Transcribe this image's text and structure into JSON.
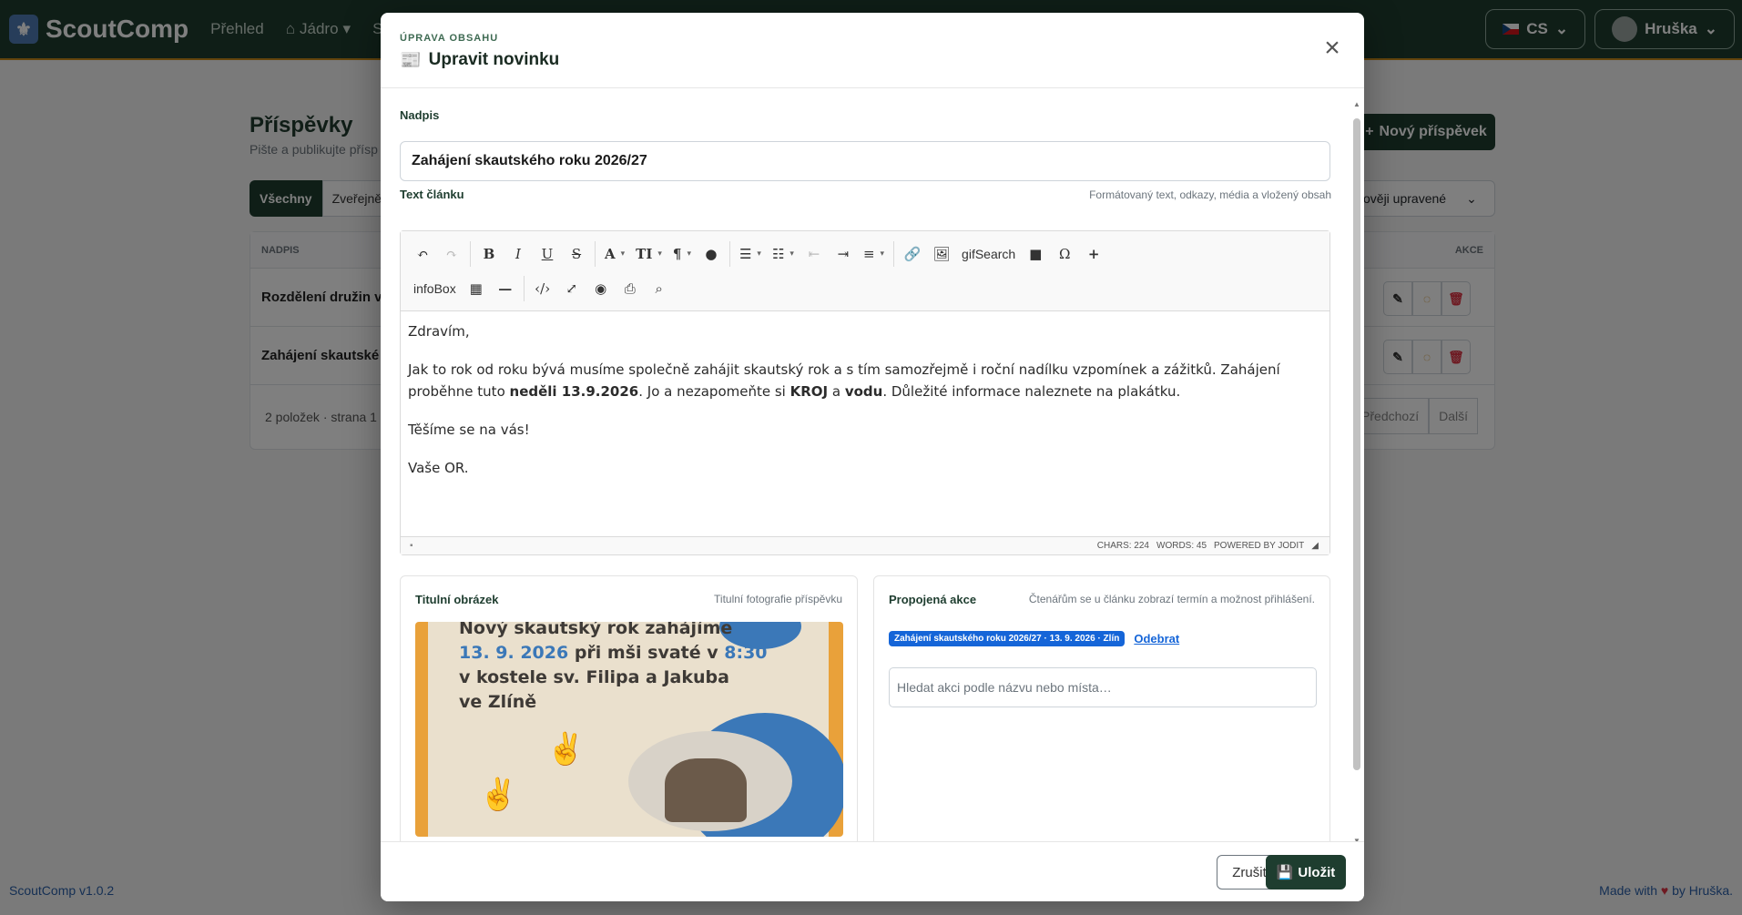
{
  "navbar": {
    "brand": "ScoutComp",
    "links": [
      "Přehled",
      "Jádro",
      "Sk"
    ],
    "lang": "CS",
    "user": "Hruška"
  },
  "page": {
    "title": "Příspěvky",
    "subtitle": "Pište a publikujte přísp",
    "new_button": "Nový příspěvek",
    "tabs": [
      "Všechny",
      "Zveřejněn"
    ],
    "sort": "ověji upravené",
    "table": {
      "col_title": "NADPIS",
      "col_actions": "AKCE",
      "rows": [
        "Rozdělení družin v",
        "Zahájení skautské"
      ]
    },
    "footer_count": "2 položek · strana 1",
    "prev": "Předchozí",
    "next": "Další"
  },
  "footer": {
    "version": "ScoutComp v1.0.2",
    "made_prefix": "Made with",
    "made_suffix": "by Hruška."
  },
  "modal": {
    "eyebrow": "ÚPRAVA OBSAHU",
    "title": "Upravit novinku",
    "heading_label": "Nadpis",
    "heading_value": "Zahájení skautského roku 2026/27",
    "text_label": "Text článku",
    "text_hint": "Formátovaný text, odkazy, média a vložený obsah",
    "toolbar": {
      "gif": "gifSearch",
      "infobox": "infoBox"
    },
    "content": {
      "p1": "Zdravím,",
      "p2_a": "Jak to rok od roku bývá musíme společně zahájit skautský rok a s tím samozřejmě i roční nadílku vzpomínek a zážitků. Zahájení proběhne tuto ",
      "p2_b": "neděli 13.9.2026",
      "p2_c": ". Jo a nezapomeňte si ",
      "p2_d": "KROJ",
      "p2_e": " a ",
      "p2_f": "vodu",
      "p2_g": ". Důležité informace naleznete na plakátku.",
      "p3": "Těšíme se na vás!",
      "p4": "Vaše OR."
    },
    "status": {
      "chars": "CHARS: 224",
      "words": "WORDS: 45",
      "powered": "POWERED BY JODIT"
    },
    "cover": {
      "title": "Titulní obrázek",
      "hint": "Titulní fotografie příspěvku",
      "poster_line1": "Nový skautský rok zahájíme",
      "poster_line2a": "13. 9. 2026",
      "poster_line2b": " při mši svaté v ",
      "poster_line2c": "8:30",
      "poster_line3": "v kostele sv. Filipa a Jakuba",
      "poster_line4": "ve Zlíně"
    },
    "event": {
      "title": "Propojená akce",
      "hint": "Čtenářům se u článku zobrazí termín a možnost přihlášení.",
      "badge": "Zahájení skautského roku 2026/27 · 13. 9. 2026 · Zlín",
      "remove": "Odebrat",
      "search_placeholder": "Hledat akci podle názvu nebo místa…"
    },
    "cancel": "Zrušit",
    "save": "Uložit"
  }
}
